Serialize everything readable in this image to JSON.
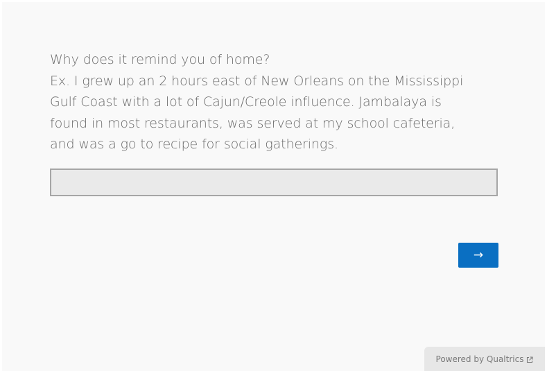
{
  "question": {
    "lines": [
      "Why does it remind you of home?",
      "Ex. I grew up an 2 hours east of New Orleans on the Mississippi",
      "Gulf Coast with a lot of Cajun/Creole influence. Jambalaya is",
      "found in most restaurants, was served at my school cafeteria,",
      "and was a go to recipe for social gatherings."
    ]
  },
  "answer": {
    "value": "",
    "placeholder": ""
  },
  "navigation": {
    "next_label": "→"
  },
  "footer": {
    "powered_by_label": "Powered by Qualtrics",
    "icon": "external-link-icon"
  },
  "colors": {
    "accent": "#0a6fc2",
    "text": "#6b6b6b",
    "page_background": "#f9f9f9",
    "input_background": "#eaeaea",
    "footer_background": "#e7e7e7"
  }
}
